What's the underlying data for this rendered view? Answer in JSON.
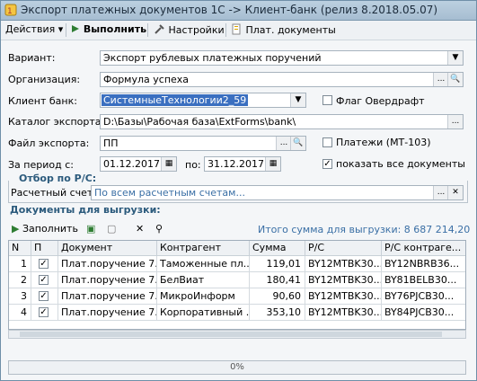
{
  "window": {
    "title": "Экспорт платежных документов 1С -> Клиент-банк (релиз 8.2018.05.07)"
  },
  "toolbar": {
    "actions_label": "Действия",
    "execute_label": "Выполнить",
    "settings_label": "Настройки",
    "docs_label": "Плат. документы"
  },
  "form": {
    "variant_label": "Вариант:",
    "variant_value": "Экспорт рублевых платежных поручений",
    "org_label": "Организация:",
    "org_value": "Формула успеха",
    "bank_client_label": "Клиент банк:",
    "bank_client_value": "СистемныеТехнологии2_59",
    "overdraft_label": "Флаг Овердрафт",
    "export_dir_label": "Каталог экспорта:",
    "export_dir_value": "D:\\Базы\\Рабочая база\\ExtForms\\bank\\",
    "export_file_label": "Файл экспорта:",
    "export_file_value": "ПП",
    "payments_label": "Платежи  (МТ-103)",
    "period_label": "За период с:",
    "period_from": "01.12.2017",
    "period_to_label": "по:",
    "period_to": "31.12.2017",
    "show_all_label": "показать все документы"
  },
  "filter": {
    "section_label": "Отбор по Р/С:",
    "account_label": "Расчетный счет:",
    "account_value": "По всем расчетным счетам..."
  },
  "docs": {
    "section_label": "Документы для выгрузки:",
    "fill_label": "Заполнить",
    "total_label": "Итого сумма для выгрузки: 8 687 214,20"
  },
  "table": {
    "headers": [
      "N",
      "П",
      "Документ",
      "Контрагент",
      "Сумма",
      "Р/С",
      "Р/С контраге..."
    ],
    "rows": [
      {
        "n": "1",
        "doc": "Плат.поручение 7...",
        "contractor": "Таможенные пл...",
        "sum": "119,01",
        "rs": "BY12MTBK30...",
        "rs_c": "BY12NBRB36..."
      },
      {
        "n": "2",
        "doc": "Плат.поручение 7...",
        "contractor": "БелВиат",
        "sum": "180,41",
        "rs": "BY12MTBK30...",
        "rs_c": "BY81BELB30..."
      },
      {
        "n": "3",
        "doc": "Плат.поручение 7...",
        "contractor": "МикроИнформ",
        "sum": "90,60",
        "rs": "BY12MTBK30...",
        "rs_c": "BY76PJCB30..."
      },
      {
        "n": "4",
        "doc": "Плат.поручение 7...",
        "contractor": "Корпоративный ...",
        "sum": "353,10",
        "rs": "BY12MTBK30...",
        "rs_c": "BY84PJCB30..."
      }
    ]
  },
  "progress": {
    "label": "0%",
    "value": 0
  }
}
